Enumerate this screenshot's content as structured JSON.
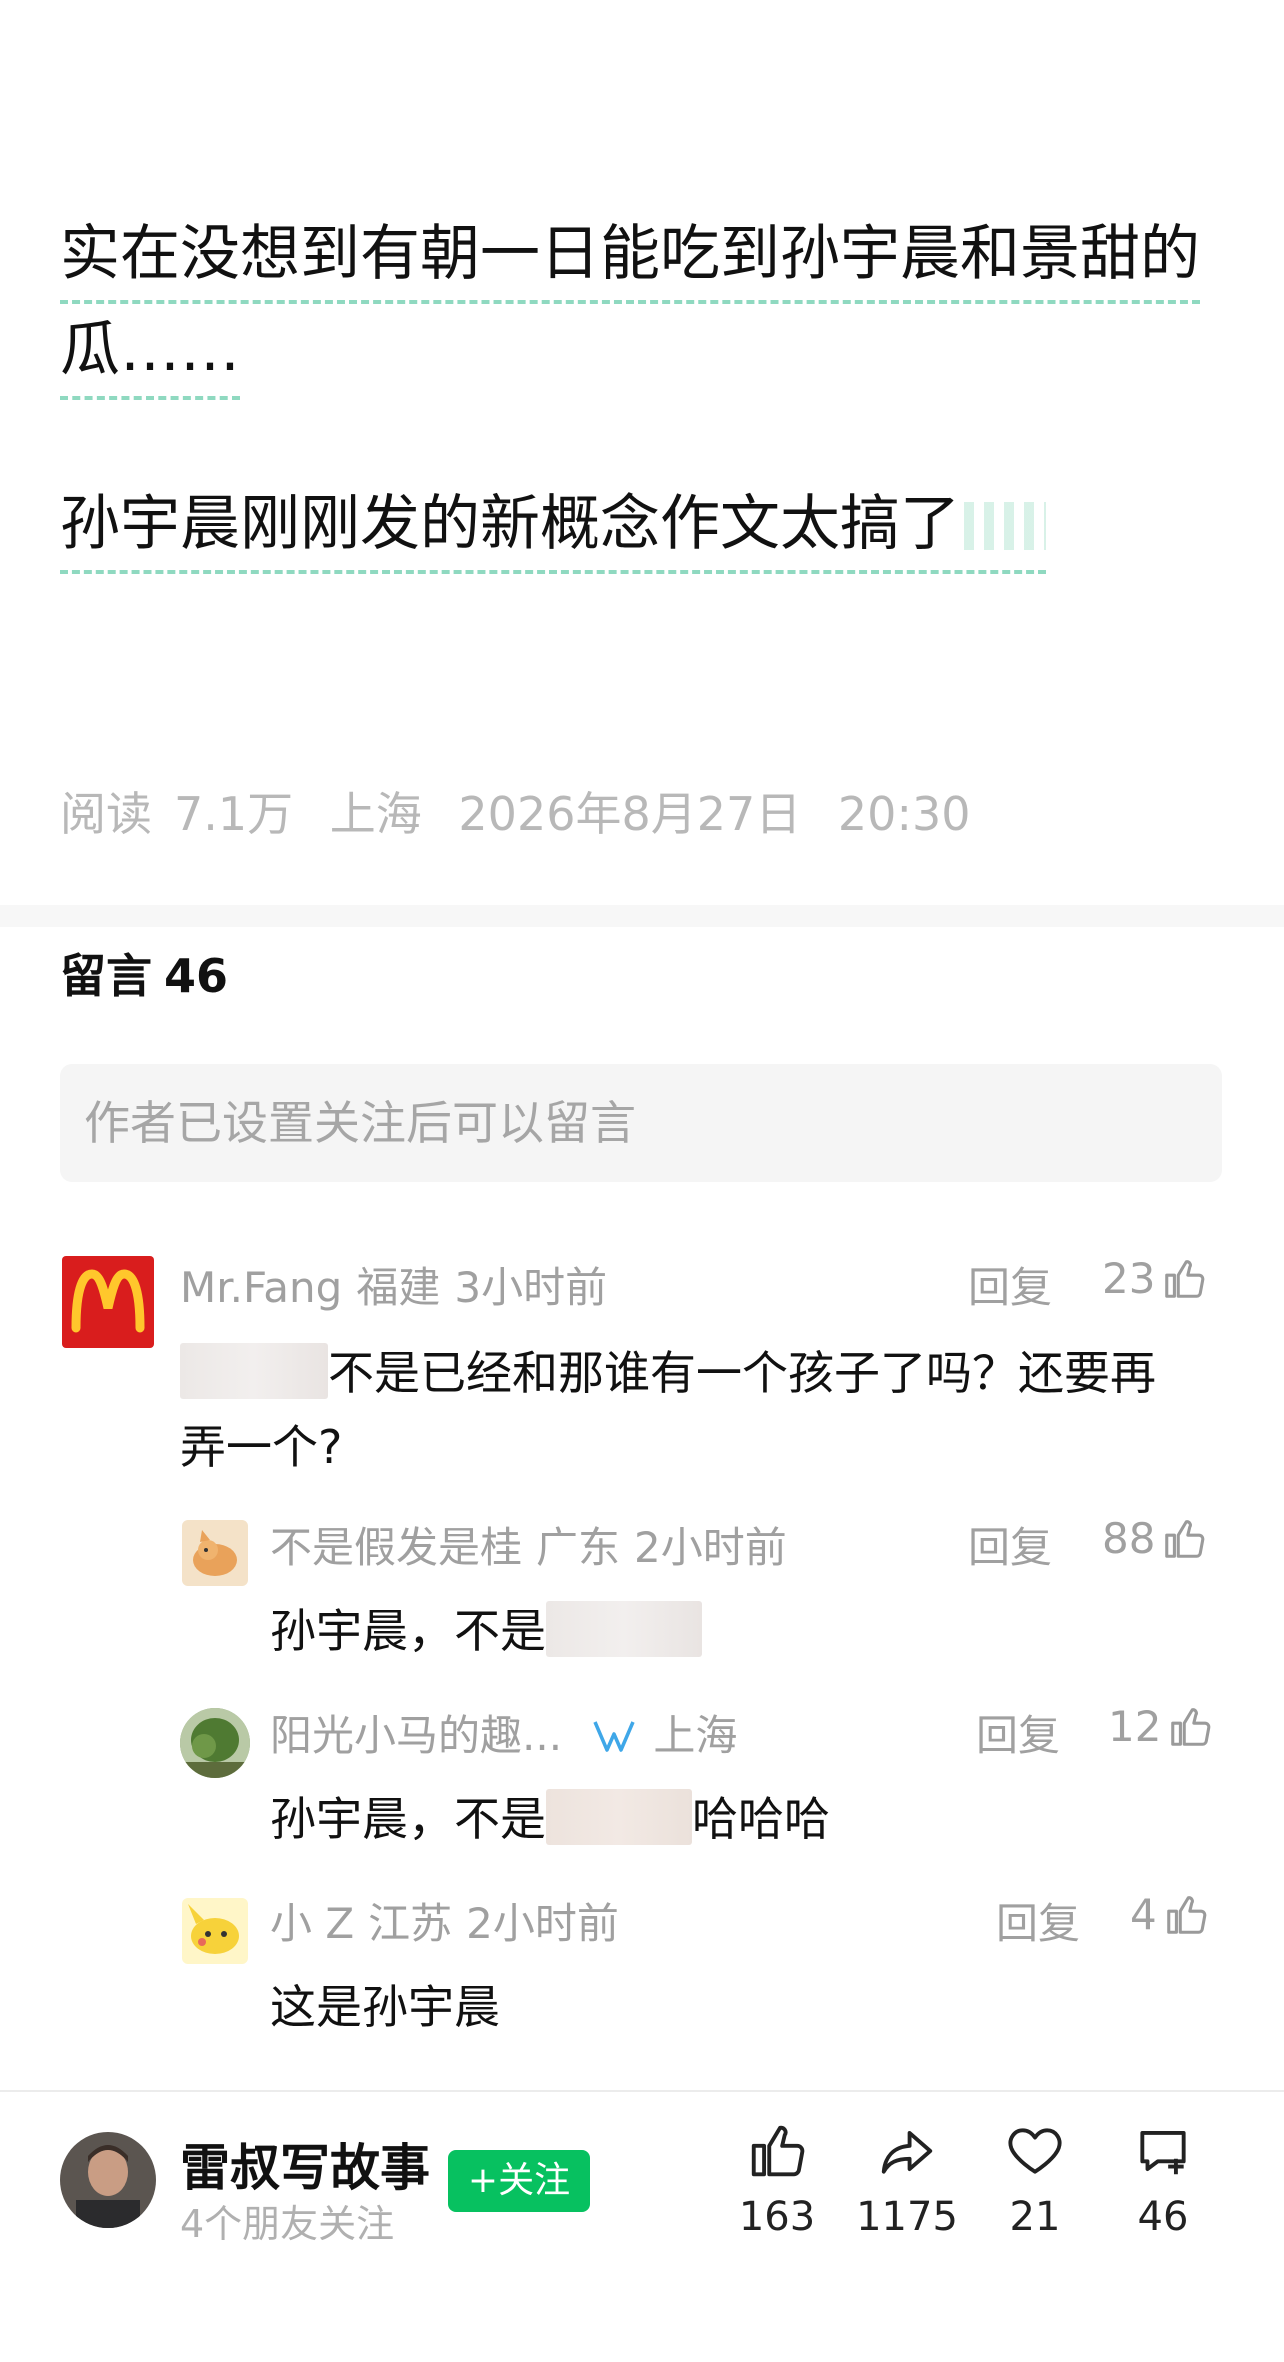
{
  "article": {
    "para1_line1": "实在没想到有朝一日能吃到孙宇晨和景甜的",
    "para1_line2": "瓜……",
    "para2": "孙宇晨刚刚发的新概念作文太搞了"
  },
  "meta": {
    "read_label": "阅读",
    "read_count": "7.1万",
    "location": "上海",
    "date": "2026年8月27日",
    "time": "20:30"
  },
  "comments_section": {
    "title": "留言",
    "count": "46",
    "input_placeholder": "作者已设置关注后可以留言"
  },
  "comments": [
    {
      "user": "Mr.Fang",
      "location": "福建",
      "time": "3小时前",
      "reply_label": "回复",
      "likes": "23",
      "text_after_blur": "不是已经和那谁有一个孩子了吗？还要再",
      "text_line2": "弄一个?",
      "avatar_icon": "mcdonalds-logo-icon"
    },
    {
      "user": "不是假发是桂",
      "location": "广东",
      "time": "2小时前",
      "reply_label": "回复",
      "likes": "88",
      "text_before_blur": "孙宇晨，不是",
      "avatar_icon": "cat-avatar-icon"
    },
    {
      "user": "阳光小马的趣...",
      "location": "上海",
      "time": "",
      "reply_label": "回复",
      "likes": "12",
      "text_before_blur": "孙宇晨，不是",
      "text_after_blur": "哈哈哈",
      "avatar_icon": "tree-avatar-icon",
      "badge_icon": "wechat-channels-icon"
    },
    {
      "user": "小 Z",
      "location": "江苏",
      "time": "2小时前",
      "reply_label": "回复",
      "likes": "4",
      "text": "这是孙宇晨",
      "avatar_icon": "pikachu-avatar-icon"
    }
  ],
  "author": {
    "name": "雷叔写故事",
    "friends_following": "4个朋友关注",
    "follow_label": "+关注"
  },
  "actions": [
    {
      "icon": "thumb-up-icon",
      "count": "163"
    },
    {
      "icon": "share-icon",
      "count": "1175"
    },
    {
      "icon": "heart-icon",
      "count": "21"
    },
    {
      "icon": "comment-icon",
      "count": "46"
    }
  ],
  "colors": {
    "accent_green": "#07c160",
    "underline": "#8fd9c0",
    "muted_text": "#a0a0a0"
  }
}
